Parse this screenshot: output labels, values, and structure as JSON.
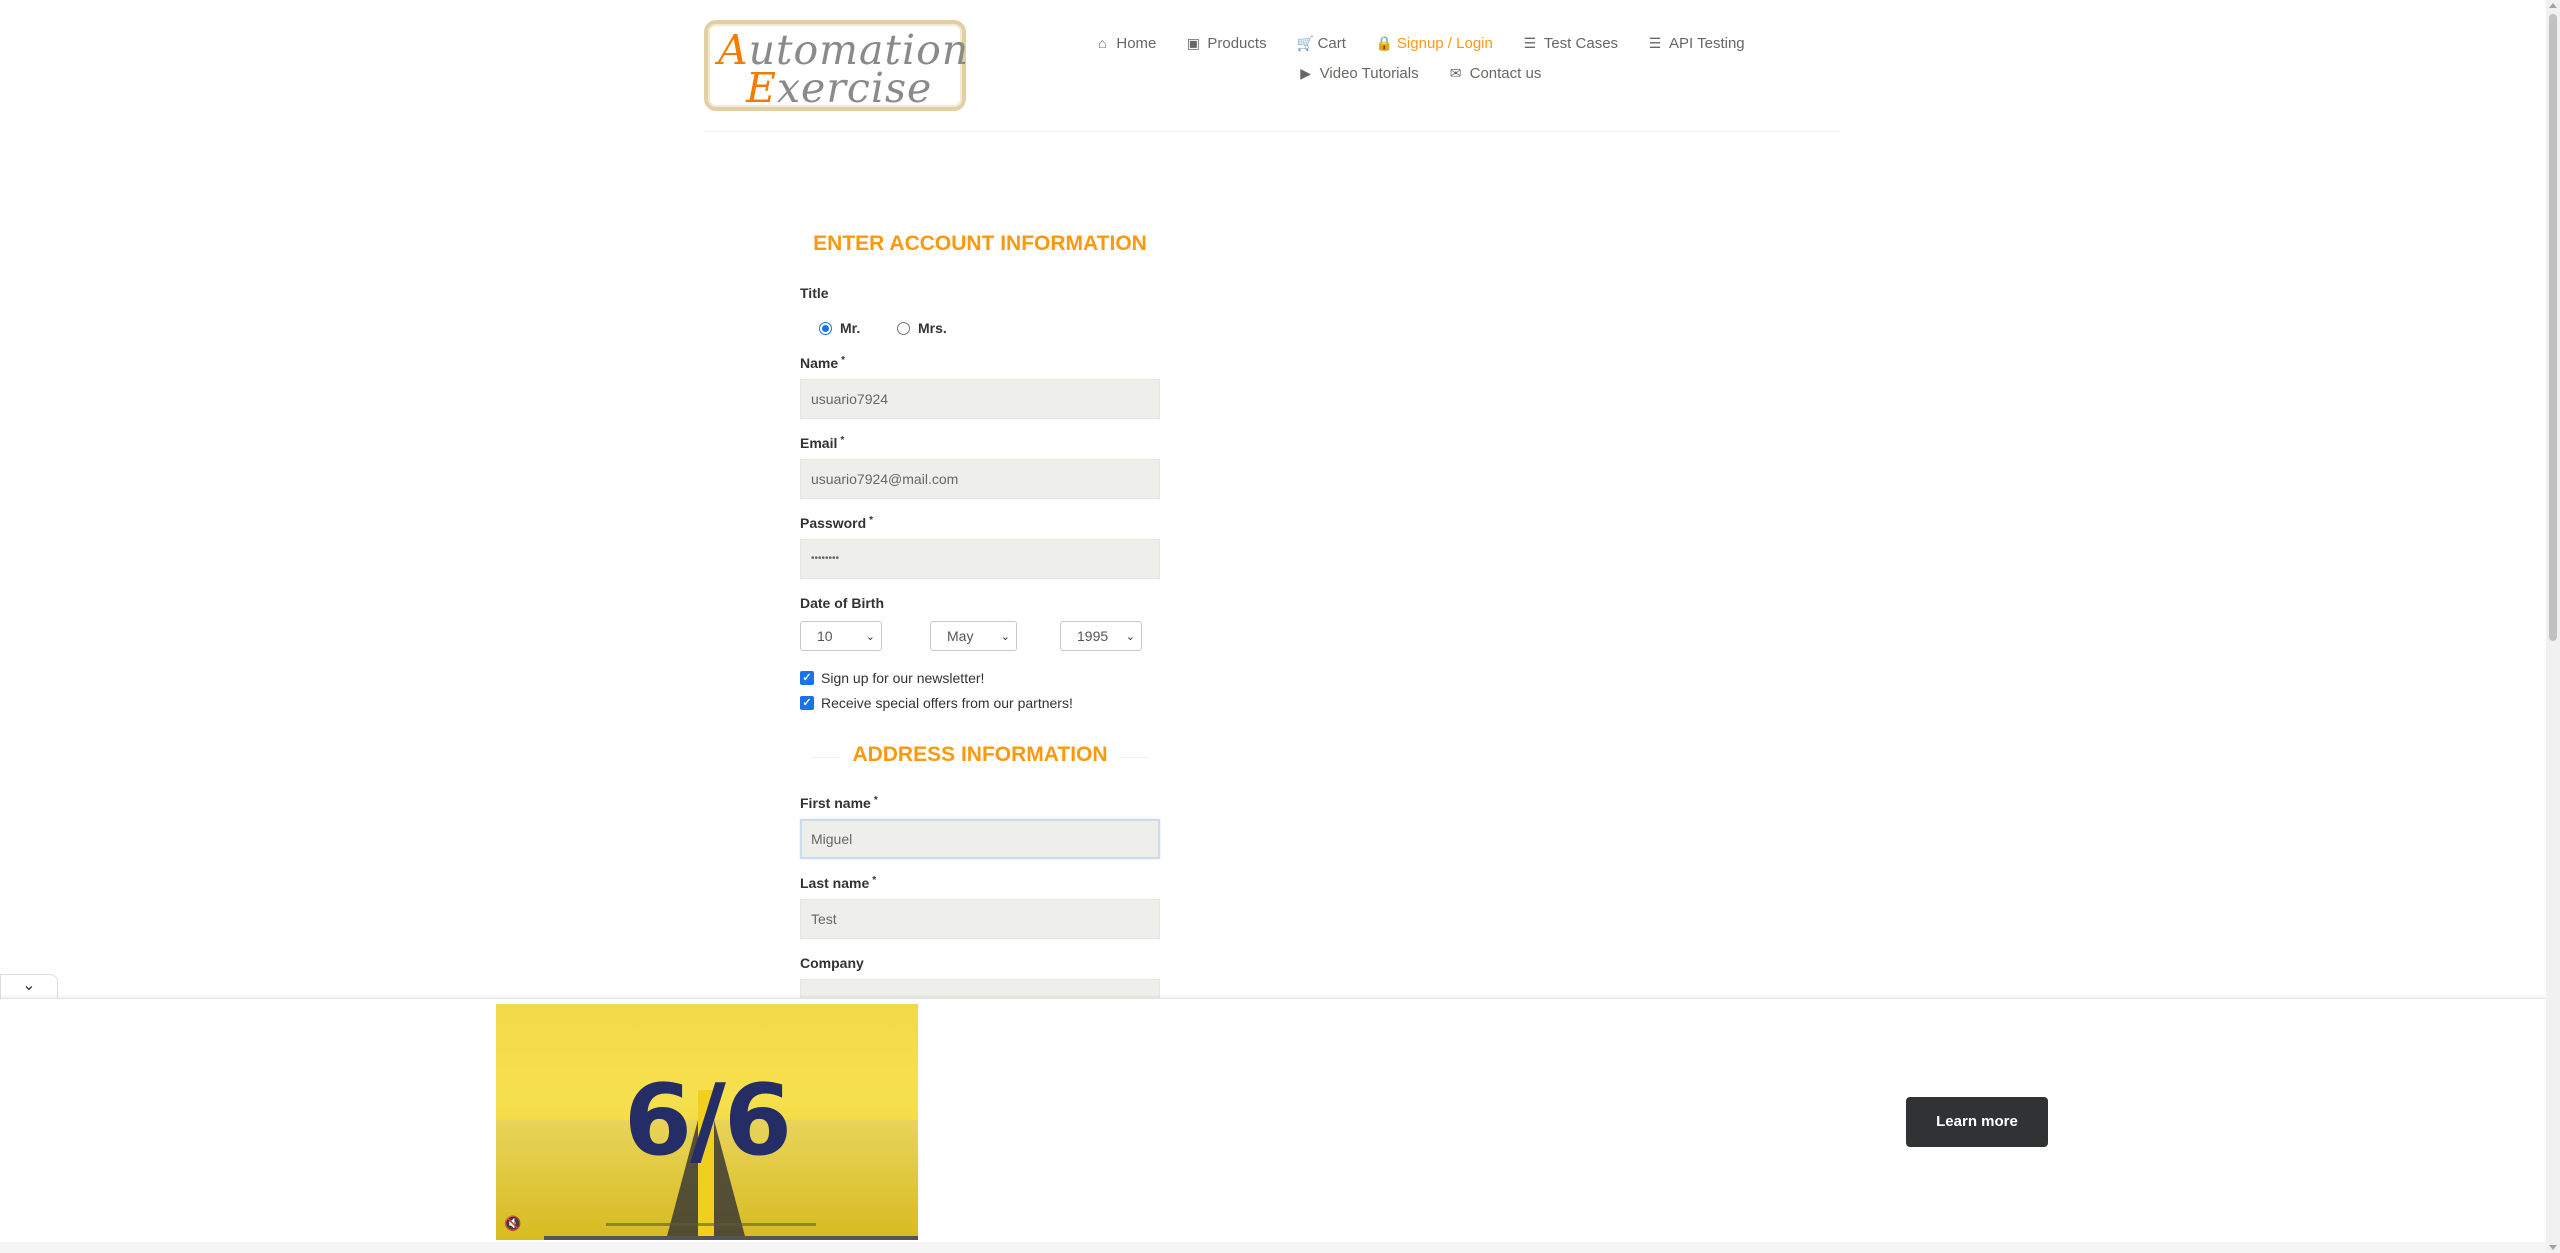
{
  "logo": {
    "line1_cap": "A",
    "line1_rest": "utomation",
    "line2_cap": "E",
    "line2_rest": "xercise"
  },
  "nav": {
    "row1": [
      {
        "icon": "home-icon",
        "glyph": "⌂",
        "label": "Home",
        "active": false
      },
      {
        "icon": "briefcase-icon",
        "glyph": "▣",
        "label": "Products",
        "active": false
      },
      {
        "icon": "cart-icon",
        "glyph": "🛒",
        "label": "Cart",
        "active": false
      },
      {
        "icon": "lock-icon",
        "glyph": "🔒",
        "label": "Signup / Login",
        "active": true
      },
      {
        "icon": "list-icon",
        "glyph": "☰",
        "label": "Test Cases",
        "active": false
      },
      {
        "icon": "list-icon",
        "glyph": "☰",
        "label": "API Testing",
        "active": false
      }
    ],
    "row2": [
      {
        "icon": "youtube-icon",
        "glyph": "▶",
        "label": "Video Tutorials",
        "active": false
      },
      {
        "icon": "envelope-icon",
        "glyph": "✉",
        "label": "Contact us",
        "active": false
      }
    ]
  },
  "form": {
    "title": "ENTER ACCOUNT INFORMATION",
    "title_label": "Title",
    "mr": "Mr.",
    "mrs": "Mrs.",
    "name_label": "Name",
    "name_value": "usuario7924",
    "email_label": "Email",
    "email_value": "usuario7924@mail.com",
    "password_label": "Password",
    "password_value": "••••••••",
    "dob_label": "Date of Birth",
    "dob_day": "10",
    "dob_month": "May",
    "dob_year": "1995",
    "newsletter": "Sign up for our newsletter!",
    "offers": "Receive special offers from our partners!",
    "address_title": "ADDRESS INFORMATION",
    "first_name_label": "First name",
    "first_name_value": "Miguel",
    "last_name_label": "Last name",
    "last_name_value": "Test",
    "company_label": "Company",
    "required_mark": "*"
  },
  "ad": {
    "big_text": "6/6",
    "learn_more": "Learn more",
    "mute_glyph": "🔇",
    "collapse_glyph": "⌄"
  },
  "colors": {
    "accent": "#fe980f",
    "input_bg": "#eeeeea",
    "checkbox": "#1a73e8"
  }
}
